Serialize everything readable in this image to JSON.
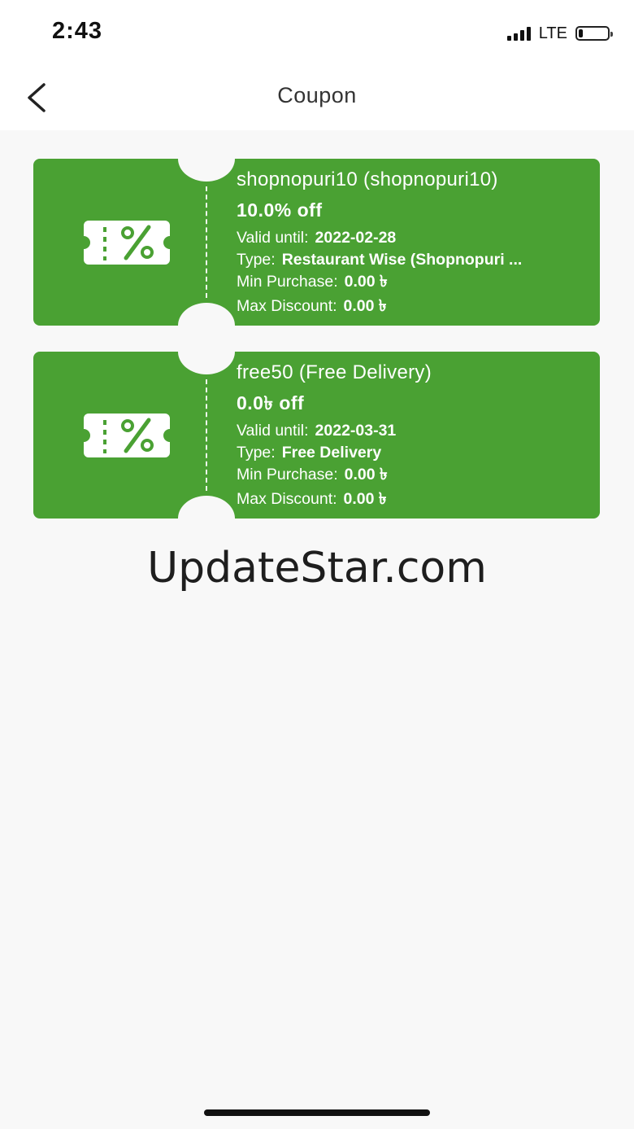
{
  "status_bar": {
    "time": "2:43",
    "network": "LTE",
    "battery_level": 0.15
  },
  "header": {
    "title": "Coupon",
    "back_icon": "chevron-left-icon"
  },
  "coupons": [
    {
      "title": "shopnopuri10 (shopnopuri10)",
      "discount": "10.0% off",
      "valid_label": "Valid until:",
      "valid_until": "2022-02-28",
      "type_label": "Type:",
      "type": "Restaurant Wise (Shopnopuri ...",
      "min_label": "Min Purchase:",
      "min_purchase": "0.00 ৳",
      "max_label": "Max Discount:",
      "max_discount": "0.00 ৳",
      "icon": "coupon-ticket-icon"
    },
    {
      "title": "free50 (Free Delivery)",
      "discount": "0.0৳ off",
      "valid_label": "Valid until:",
      "valid_until": "2022-03-31",
      "type_label": "Type:",
      "type": "Free Delivery",
      "min_label": "Min Purchase:",
      "min_purchase": "0.00 ৳",
      "max_label": "Max Discount:",
      "max_discount": "0.00 ৳",
      "icon": "coupon-ticket-icon"
    }
  ],
  "watermark": "UpdateStar.com",
  "colors": {
    "coupon_bg": "#4aa133",
    "page_bg": "#f8f8f8"
  }
}
